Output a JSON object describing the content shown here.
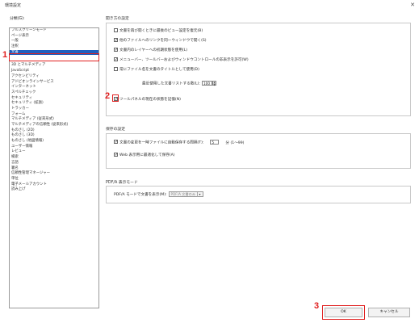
{
  "window": {
    "title": "環境設定",
    "close_glyph": "✕"
  },
  "categories": {
    "label": "分類(G):",
    "top_items": [
      "フルスクリーンモード",
      "ページ表示",
      "一般",
      "注釈",
      "文書"
    ],
    "bottom_items": [
      "3D とマルチメディア",
      "JavaScript",
      "アクセシビリティ",
      "アドビオンラインサービス",
      "インターネット",
      "スペルチェック",
      "セキュリティ",
      "セキュリティ (拡張)",
      "トラッカー",
      "フォーム",
      "マルチメディア (従来形式)",
      "マルチメディアの信頼性 (従来形式)",
      "ものさし (2D)",
      "ものさし (3D)",
      "ものさし (地図情報)",
      "ユーザー情報",
      "レビュー",
      "検索",
      "言語",
      "署名",
      "信頼性管理マネージャー",
      "単位",
      "電子メールアカウント",
      "読み上げ"
    ],
    "selected": "文書"
  },
  "open_settings": {
    "title": "開き方の設定",
    "options": [
      {
        "label": "文書を再び開くときに最後のビュー設定を復元(B)",
        "checked": false
      },
      {
        "label": "他のファイルへのリンクを同一ウィンドウで開く(S)",
        "checked": true
      },
      {
        "label": "文書内のレイヤーへの初期状態を使用(L)",
        "checked": true
      },
      {
        "label": "メニューバー、ツールバーおよびウィンドウコントロールの非表示を許可(W)",
        "checked": true
      },
      {
        "label": "常にファイル名を文書のタイトルとして使用(D)",
        "checked": false
      }
    ],
    "recent_label": "最近使用した文書リストする数(L):",
    "recent_value": "100",
    "toolpanel_label": "ツールパネルの現在の状態を記憶(N)",
    "toolpanel_checked": true
  },
  "save_settings": {
    "title": "保存の設定",
    "autosave_label": "文書の変更を一時ファイルに自動保存する間隔(T):",
    "autosave_value": "5",
    "autosave_unit": "分 (1〜99)",
    "autosave_checked": true,
    "web_label": "Web 表示用に最適化して保存(A)",
    "web_checked": true
  },
  "pdfa": {
    "title": "PDF/A 表示モード",
    "label": "PDF/A モードで文書を表示(M):",
    "value": "PDF/A 文書のみ"
  },
  "buttons": {
    "ok": "OK",
    "cancel": "キャンセル"
  },
  "annotations": {
    "step1": "1",
    "step2": "2",
    "step3": "3"
  },
  "colors": {
    "accent": "#1f5fbf",
    "annotation": "#e02020"
  }
}
